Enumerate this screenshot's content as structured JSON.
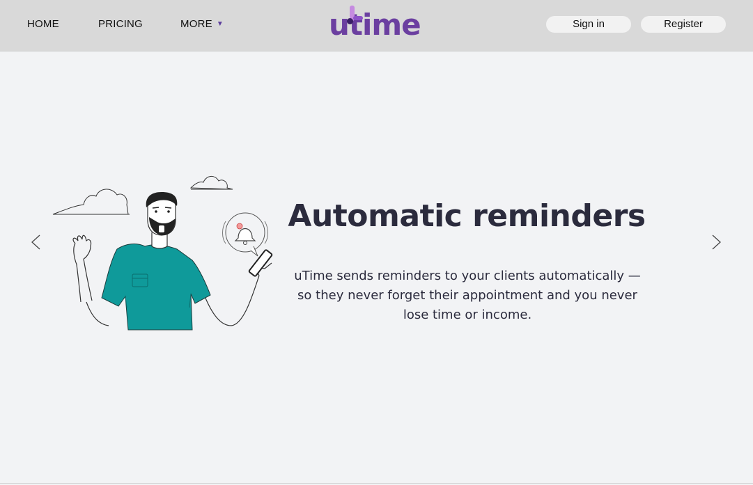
{
  "nav": {
    "home": "HOME",
    "pricing": "PRICING",
    "more": "MORE",
    "more_caret": "▼"
  },
  "logo": {
    "text": "utime",
    "color": "#6b3fa0"
  },
  "auth": {
    "sign_in": "Sign in",
    "register": "Register"
  },
  "slide": {
    "title": "Automatic reminders",
    "description": "uTime sends reminders to your clients automatically — so they never forget their appointment and you never lose time or income."
  },
  "icons": {
    "prev": "chevron-left-icon",
    "next": "chevron-right-icon",
    "illustration": "man-with-phone-reminder-illustration"
  },
  "colors": {
    "navbar_bg": "#d9d9d9",
    "page_bg": "#f2f3f5",
    "brand": "#6b3fa0",
    "shirt": "#0f9a9a",
    "title_text": "#2b2b3d"
  }
}
